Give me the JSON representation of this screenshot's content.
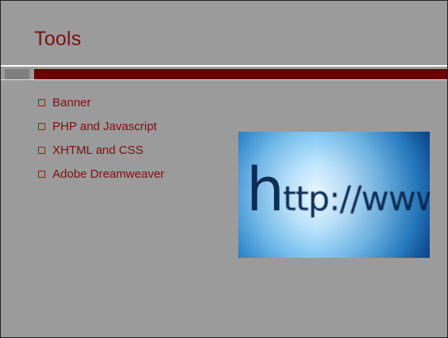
{
  "slide": {
    "title": "Tools",
    "bullets": [
      "Banner",
      "PHP and Javascript",
      "XHTML and CSS",
      "Adobe Dreamweaver"
    ]
  },
  "image": {
    "text_large": "h",
    "text_rest": "ttp://www"
  },
  "colors": {
    "background": "#9b9b9b",
    "title": "#7a0f12",
    "accent_bar": "#6b0000",
    "accent_block": "#7f7f7f",
    "rule": "#ffffff"
  }
}
